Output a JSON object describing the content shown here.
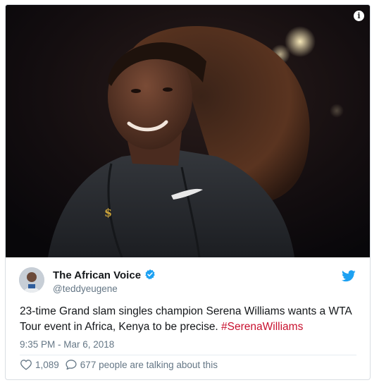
{
  "tweet": {
    "author_name": "The African Voice",
    "handle": "@teddyeugene",
    "text": "23-time Grand slam singles champion Serena Williams wants a WTA Tour event in Africa, Kenya to be precise. ",
    "hashtag": "#SerenaWilliams",
    "timestamp": "9:35 PM - Mar 6, 2018",
    "likes": "1,089",
    "conversation": "677 people are talking about this"
  },
  "icons": {
    "info": "info-icon",
    "verified": "verified-badge-icon",
    "bird": "twitter-bird-icon",
    "like": "heart-icon",
    "reply": "reply-bubble-icon"
  },
  "colors": {
    "verified_blue": "#1da1f2",
    "hashtag_red": "#c8102e",
    "muted_gray": "#657786",
    "text_dark": "#14171a"
  },
  "info_glyph": "i"
}
